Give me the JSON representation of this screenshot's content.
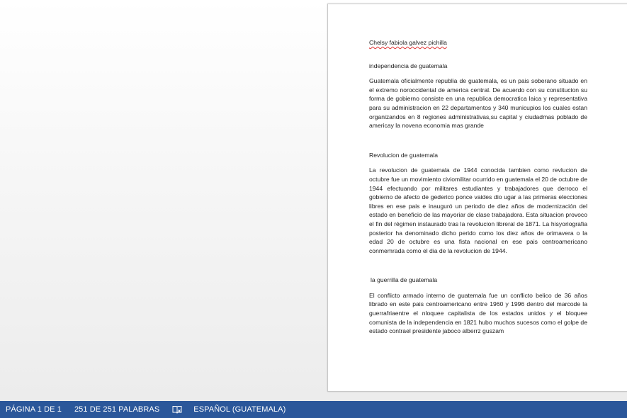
{
  "document": {
    "author": "Chelsy fabiola galvez pichilla",
    "sections": [
      {
        "heading": "independencia de guatemala",
        "body": "Guatemala oficialmente republia de guatemala, es un pais soberano situado en el extremo noroccidental de america central. De acuerdo con su constitucion su forma de gobierno consiste en una republica democratica laica y representativa para su administracion en 22 departamentos y 340 municupios los cuales estan organizandos en 8 regiones administrativas,su capital y ciudadmas poblado de americay la novena economia mas grande"
      },
      {
        "heading": "Revolucion de guatemala",
        "body": "La revolucion de guatemala de 1944 conocida tambien como revlucion de octubre fue un movimiento civiomilitar ocurrido en guatemala el 20 de octubre de 1944 efectuando por militares estudiantes y trabajadores que derroco el gobierno de afecto de gederico ponce vaides dio ugar a las primeras elecciones libres en ese pais e inauguró un periodo de diez años de modernización del estado en beneficio de las mayoriar de clase trabajadora. Esta situacion provoco el fin del régimen instaurado tras la revolucion libreral de 1871. La hisyoriografia posterior ha denominado dicho perido como los diez años de orimavera o la edad 20 de octubre es una fista nacional en ese pais centroamericano conmemrada como el dia de la revolucion de 1944."
      },
      {
        "heading": "la guerrilla de guatemala",
        "body": "El conflicto armado interno de guatemala fue un conflicto belico de 36 años librado en este pais centroamericano entre 1960 y 1996 dentro del marcode la guerrafriaentre el nloquee capitalista de los estados unidos y el bloquee comunista de la independencia en 1821 hubo muchos sucesos como el golpe de estado contrael presidente jaboco alberrz guszam"
      }
    ]
  },
  "statusbar": {
    "page": "PÁGINA 1 DE 1",
    "words": "251 DE 251 PALABRAS",
    "language": "ESPAÑOL (GUATEMALA)",
    "proofing_icon": "book-check-icon",
    "background_color": "#2b579a"
  }
}
